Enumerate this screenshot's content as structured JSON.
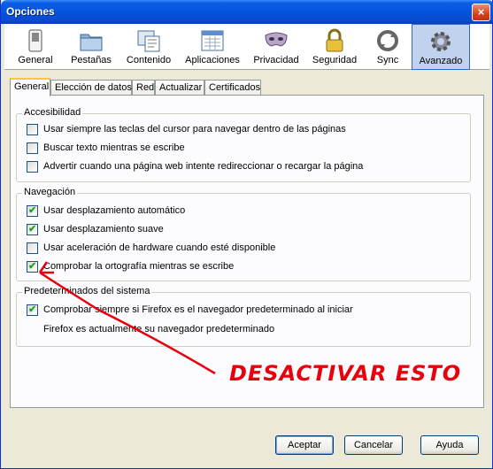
{
  "window": {
    "title": "Opciones",
    "close_glyph": "×"
  },
  "toolbar": {
    "items": [
      {
        "label": "General",
        "icon": "switch-icon"
      },
      {
        "label": "Pestañas",
        "icon": "folder-tabs-icon"
      },
      {
        "label": "Contenido",
        "icon": "content-icon"
      },
      {
        "label": "Aplicaciones",
        "icon": "applications-icon"
      },
      {
        "label": "Privacidad",
        "icon": "mask-icon"
      },
      {
        "label": "Seguridad",
        "icon": "padlock-icon"
      },
      {
        "label": "Sync",
        "icon": "sync-icon"
      },
      {
        "label": "Avanzado",
        "icon": "gear-icon"
      }
    ],
    "active": "Avanzado"
  },
  "tabs": [
    "General",
    "Elección de datos",
    "Red",
    "Actualizar",
    "Certificados"
  ],
  "active_tab": "General",
  "accesibilidad": {
    "label": "Accesibilidad",
    "options": [
      {
        "text": "Usar siempre las teclas del cursor para navegar dentro de las páginas",
        "checked": false
      },
      {
        "text": "Buscar texto mientras se escribe",
        "checked": false
      },
      {
        "text": "Advertir cuando una página web intente redireccionar o recargar la página",
        "checked": false
      }
    ]
  },
  "navegacion": {
    "label": "Navegación",
    "options": [
      {
        "text": "Usar desplazamiento automático",
        "checked": true
      },
      {
        "text": "Usar desplazamiento suave",
        "checked": true
      },
      {
        "text": "Usar aceleración de hardware cuando esté disponible",
        "checked": false
      },
      {
        "text": "Comprobar la ortografía mientras se escribe",
        "checked": true
      }
    ]
  },
  "sistema": {
    "label": "Predeterminados del sistema",
    "option": {
      "text": "Comprobar siempre si Firefox es el navegador predeterminado al iniciar",
      "checked": true
    },
    "status": "Firefox es actualmente su navegador predeterminado"
  },
  "annotation": {
    "text": "DESACTIVAR ESTO",
    "color": "#e8000c"
  },
  "buttons": {
    "accept": "Aceptar",
    "cancel": "Cancelar",
    "help": "Ayuda"
  },
  "colors": {
    "titlebar": "#0453dc",
    "active_tab_accent": "#ffc83c",
    "check": "#21a121"
  }
}
